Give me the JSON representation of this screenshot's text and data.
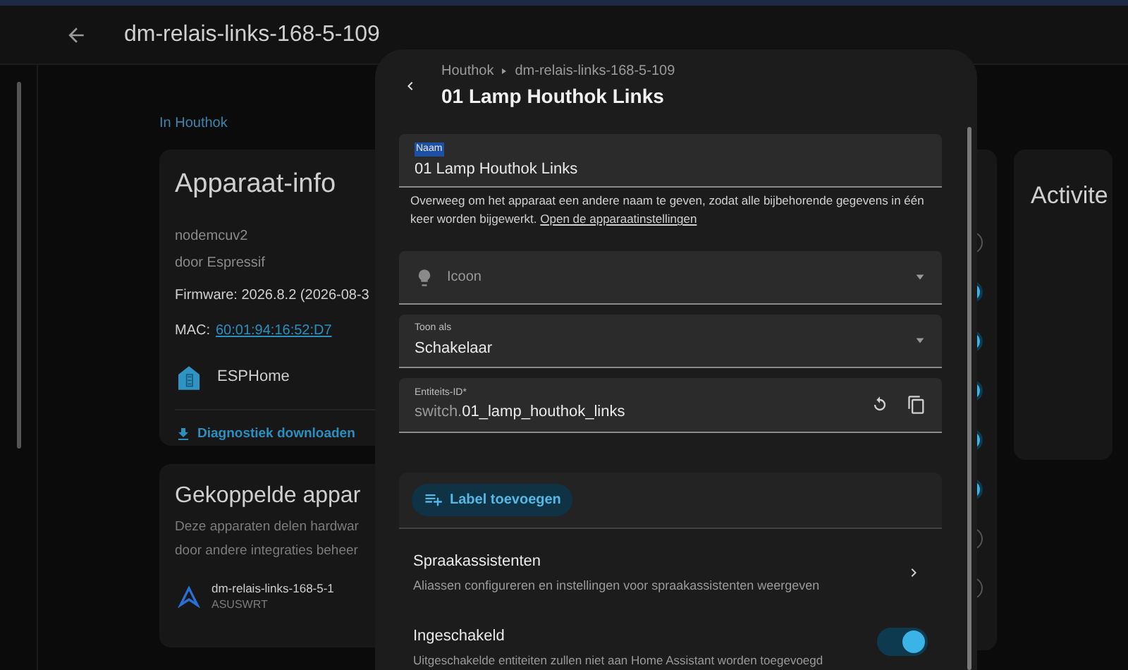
{
  "top_bar": {
    "title": "dm-relais-links-168-5-109"
  },
  "area_link": "In Houthok",
  "device_info": {
    "title": "Apparaat-info",
    "model": "nodemcuv2",
    "manufacturer": "door Espressif",
    "firmware": "Firmware: 2026.8.2 (2026-08-3",
    "mac_label": "MAC:",
    "mac": "60:01:94:16:52:D7",
    "integration": "ESPHome",
    "download": "Diagnostiek downloaden"
  },
  "linked_devices": {
    "title": "Gekoppelde appar",
    "description": [
      "Deze apparaten delen hardwar",
      "door andere integraties beheer"
    ],
    "device": {
      "name": "dm-relais-links-168-5-1",
      "integration": "ASUSWRT"
    }
  },
  "entity_toggles": [
    {
      "on": false
    },
    {
      "on": true
    },
    {
      "on": true
    },
    {
      "on": true
    },
    {
      "on": true
    },
    {
      "on": true
    },
    {
      "on": false
    },
    {
      "on": false
    }
  ],
  "activity_card": {
    "title": "Activite"
  },
  "dialog": {
    "breadcrumb": [
      "Houthok",
      "dm-relais-links-168-5-109"
    ],
    "title": "01 Lamp Houthok Links",
    "name_field": {
      "label": "Naam",
      "value": "01 Lamp Houthok Links"
    },
    "helper": "Overweeg om het apparaat een andere naam te geven, zodat alle bijbehorende gegevens in één keer worden bijgewerkt.",
    "helper_link": "Open de apparaatinstellingen",
    "icon_field": {
      "placeholder": "Icoon"
    },
    "show_as": {
      "label": "Toon als",
      "value": "Schakelaar"
    },
    "entity_id": {
      "label": "Entiteits-ID*",
      "prefix": "switch.",
      "value": "01_lamp_houthok_links"
    },
    "add_label": "Label toevoegen",
    "voice": {
      "title": "Spraakassistenten",
      "description": "Aliassen configureren en instellingen voor spraakassistenten weergeven"
    },
    "enabled": {
      "title": "Ingeschakeld",
      "description": "Uitgeschakelde entiteiten zullen niet aan Home Assistant worden toegevoegd",
      "on": true
    }
  }
}
